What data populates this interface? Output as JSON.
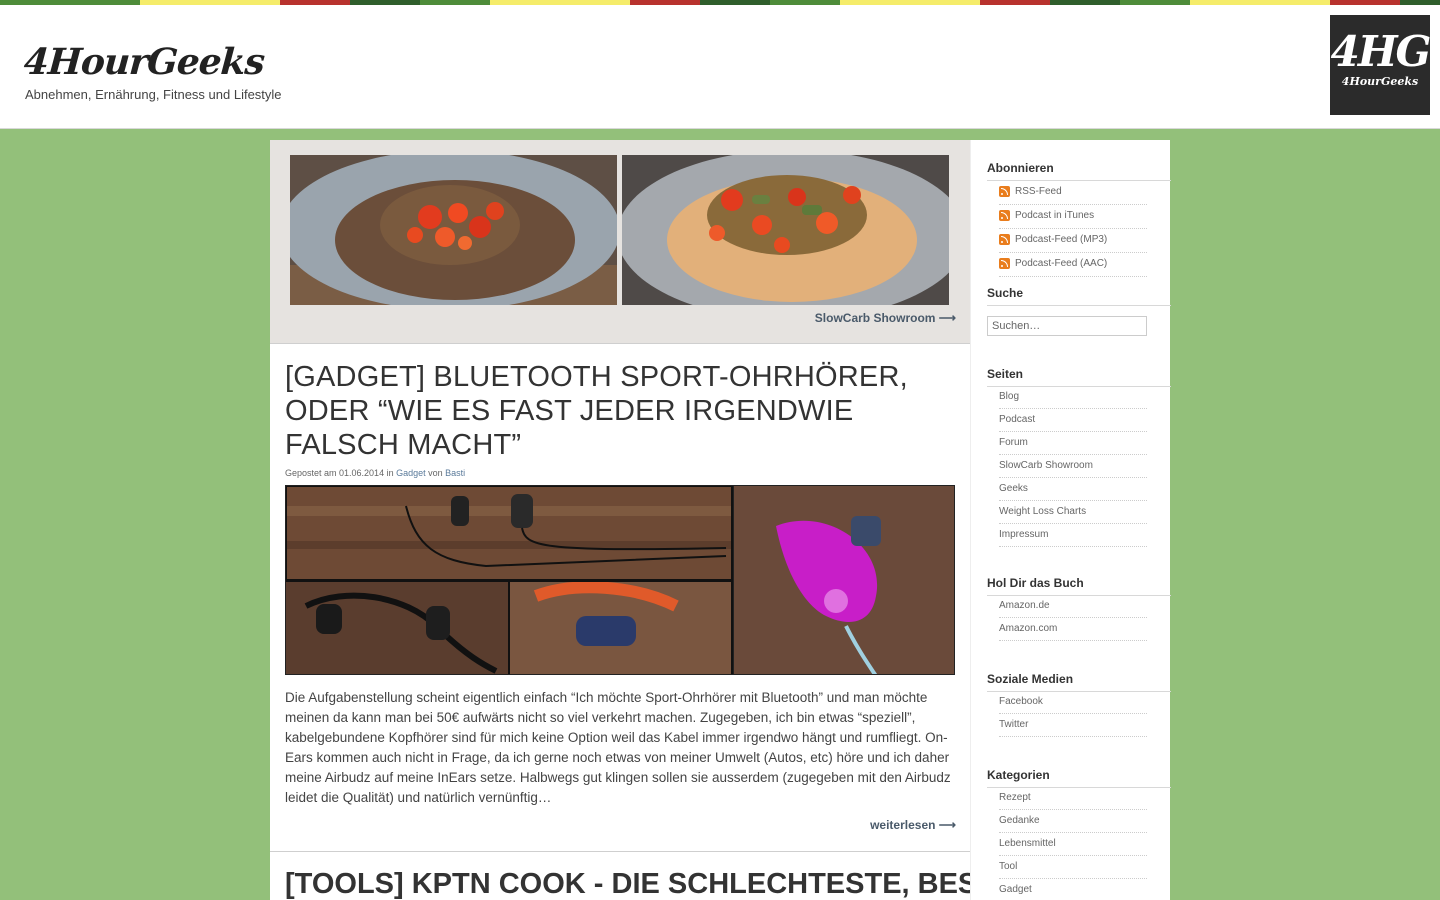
{
  "stripe_colors": [
    "#4e8c3a",
    "#4e8c3a",
    "#f5ec6a",
    "#f5ec6a",
    "#b8322e",
    "#2f5e2c",
    "#4e8c3a",
    "#f5ec6a",
    "#f5ec6a",
    "#b8322e",
    "#2f5e2c",
    "#4e8c3a",
    "#f5ec6a",
    "#f5ec6a",
    "#b8322e",
    "#2f5e2c",
    "#4e8c3a",
    "#f5ec6a",
    "#f5ec6a",
    "#b8322e",
    "#2f5e2c"
  ],
  "header": {
    "site_title": "4HourGeeks",
    "tagline": "Abnehmen, Ernährung, Fitness und Lifestyle",
    "logo": {
      "big": "4HG",
      "small": "4HourGeeks"
    }
  },
  "showroom": {
    "link_label": "SlowCarb Showroom ⟶"
  },
  "post": {
    "title": "[GADGET] BLUETOOTH SPORT-OHRHÖRER, ODER “WIE ES FAST JEDER IRGENDWIE FALSCH MACHT”",
    "meta_prefix": "Gepostet am 01.06.2014 in ",
    "category": "Gadget",
    "meta_by": " von ",
    "author": "Basti",
    "excerpt": "Die Aufgabenstellung scheint eigentlich einfach “Ich möchte Sport-Ohrhörer mit Bluetooth” und man möchte meinen da kann man bei 50€ aufwärts nicht so viel verkehrt machen. Zugegeben, ich bin etwas “speziell”, kabelgebundene Kopfhörer sind für mich keine Option weil das Kabel immer irgendwo hängt und rumfliegt. On-Ears kommen auch nicht in Frage, da ich gerne noch etwas von meiner Umwelt (Autos, etc) höre und ich daher meine Airbudz auf meine InEars setze. Halbwegs gut klingen sollen sie ausserdem (zugegeben mit den Airbudz leidet die Qualität) und natürlich vernünftig…",
    "read_more": "weiterlesen ⟶"
  },
  "post2": {
    "title": "[TOOLS] KPTN COOK - DIE SCHLECHTESTE, BESTE"
  },
  "sidebar": {
    "subscribe": {
      "title": "Abonnieren",
      "items": [
        "RSS-Feed",
        "Podcast in iTunes",
        "Podcast-Feed (MP3)",
        "Podcast-Feed (AAC)"
      ]
    },
    "search": {
      "title": "Suche",
      "placeholder": "Suchen…"
    },
    "pages": {
      "title": "Seiten",
      "items": [
        "Blog",
        "Podcast",
        "Forum",
        "SlowCarb Showroom",
        "Geeks",
        "Weight Loss Charts",
        "Impressum"
      ]
    },
    "book": {
      "title": "Hol Dir das Buch",
      "items": [
        "Amazon.de",
        "Amazon.com"
      ]
    },
    "social": {
      "title": "Soziale Medien",
      "items": [
        "Facebook",
        "Twitter"
      ]
    },
    "categories": {
      "title": "Kategorien",
      "items": [
        "Rezept",
        "Gedanke",
        "Lebensmittel",
        "Tool",
        "Gadget"
      ]
    }
  }
}
